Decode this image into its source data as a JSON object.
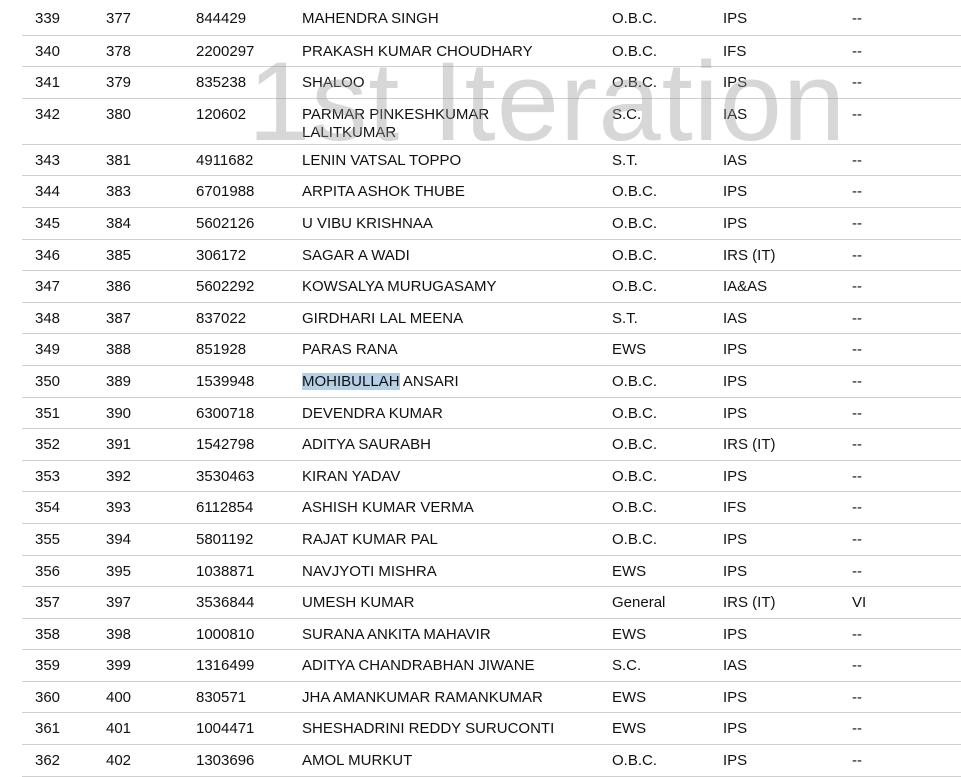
{
  "watermark": "1st Iteration",
  "rows": [
    {
      "sno": "339",
      "rank": "377",
      "roll": "844429",
      "name": "MAHENDRA SINGH",
      "category": "O.B.C.",
      "service": "IPS",
      "remarks": "--"
    },
    {
      "sno": "340",
      "rank": "378",
      "roll": "2200297",
      "name": "PRAKASH KUMAR CHOUDHARY",
      "category": "O.B.C.",
      "service": "IFS",
      "remarks": "--"
    },
    {
      "sno": "341",
      "rank": "379",
      "roll": "835238",
      "name": "SHALOO",
      "category": "O.B.C.",
      "service": "IPS",
      "remarks": "--"
    },
    {
      "sno": "342",
      "rank": "380",
      "roll": "120602",
      "name": "PARMAR PINKESHKUMAR LALITKUMAR",
      "category": "S.C.",
      "service": "IAS",
      "remarks": "--"
    },
    {
      "sno": "343",
      "rank": "381",
      "roll": "4911682",
      "name": "LENIN VATSAL TOPPO",
      "category": "S.T.",
      "service": "IAS",
      "remarks": "--"
    },
    {
      "sno": "344",
      "rank": "383",
      "roll": "6701988",
      "name": "ARPITA ASHOK THUBE",
      "category": "O.B.C.",
      "service": "IPS",
      "remarks": "--"
    },
    {
      "sno": "345",
      "rank": "384",
      "roll": "5602126",
      "name": "U VIBU KRISHNAA",
      "category": "O.B.C.",
      "service": "IPS",
      "remarks": "--"
    },
    {
      "sno": "346",
      "rank": "385",
      "roll": "306172",
      "name": "SAGAR A WADI",
      "category": "O.B.C.",
      "service": "IRS (IT)",
      "remarks": "--"
    },
    {
      "sno": "347",
      "rank": "386",
      "roll": "5602292",
      "name": "KOWSALYA MURUGASAMY",
      "category": "O.B.C.",
      "service": "IA&AS",
      "remarks": "--"
    },
    {
      "sno": "348",
      "rank": "387",
      "roll": "837022",
      "name": "GIRDHARI LAL MEENA",
      "category": "S.T.",
      "service": "IAS",
      "remarks": "--"
    },
    {
      "sno": "349",
      "rank": "388",
      "roll": "851928",
      "name": "PARAS RANA",
      "category": "EWS",
      "service": "IPS",
      "remarks": "--"
    },
    {
      "sno": "350",
      "rank": "389",
      "roll": "1539948",
      "name_highlight": "MOHIBULLAH",
      "name_rest": " ANSARI",
      "category": "O.B.C.",
      "service": "IPS",
      "remarks": "--"
    },
    {
      "sno": "351",
      "rank": "390",
      "roll": "6300718",
      "name": "DEVENDRA KUMAR",
      "category": "O.B.C.",
      "service": "IPS",
      "remarks": "--"
    },
    {
      "sno": "352",
      "rank": "391",
      "roll": "1542798",
      "name": "ADITYA SAURABH",
      "category": "O.B.C.",
      "service": "IRS (IT)",
      "remarks": "--"
    },
    {
      "sno": "353",
      "rank": "392",
      "roll": "3530463",
      "name": "KIRAN YADAV",
      "category": "O.B.C.",
      "service": "IPS",
      "remarks": "--"
    },
    {
      "sno": "354",
      "rank": "393",
      "roll": "6112854",
      "name": "ASHISH KUMAR VERMA",
      "category": "O.B.C.",
      "service": "IFS",
      "remarks": "--"
    },
    {
      "sno": "355",
      "rank": "394",
      "roll": "5801192",
      "name": "RAJAT KUMAR PAL",
      "category": "O.B.C.",
      "service": "IPS",
      "remarks": "--"
    },
    {
      "sno": "356",
      "rank": "395",
      "roll": "1038871",
      "name": "NAVJYOTI MISHRA",
      "category": "EWS",
      "service": "IPS",
      "remarks": "--"
    },
    {
      "sno": "357",
      "rank": "397",
      "roll": "3536844",
      "name": "UMESH KUMAR",
      "category": "General",
      "service": "IRS (IT)",
      "remarks": "VI"
    },
    {
      "sno": "358",
      "rank": "398",
      "roll": "1000810",
      "name": "SURANA ANKITA MAHAVIR",
      "category": "EWS",
      "service": "IPS",
      "remarks": "--"
    },
    {
      "sno": "359",
      "rank": "399",
      "roll": "1316499",
      "name": "ADITYA CHANDRABHAN JIWANE",
      "category": "S.C.",
      "service": "IAS",
      "remarks": "--"
    },
    {
      "sno": "360",
      "rank": "400",
      "roll": "830571",
      "name": "JHA AMANKUMAR RAMANKUMAR",
      "category": "EWS",
      "service": "IPS",
      "remarks": "--"
    },
    {
      "sno": "361",
      "rank": "401",
      "roll": "1004471",
      "name": "SHESHADRINI REDDY SURUCONTI",
      "category": "EWS",
      "service": "IPS",
      "remarks": "--"
    },
    {
      "sno": "362",
      "rank": "402",
      "roll": "1303696",
      "name": "AMOL MURKUT",
      "category": "O.B.C.",
      "service": "IPS",
      "remarks": "--"
    }
  ]
}
